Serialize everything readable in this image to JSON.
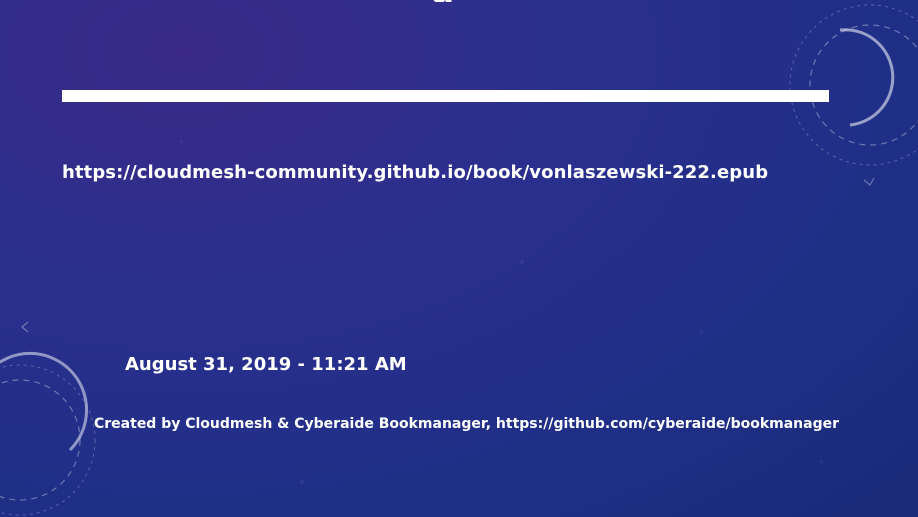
{
  "slide": {
    "title_fragment": "g",
    "url": "https://cloudmesh-community.github.io/book/vonlaszewski-222.epub",
    "date": "August 31, 2019 - 11:21 AM",
    "footer": "Created by Cloudmesh & Cyberaide Bookmanager, https://github.com/cyberaide/bookmanager"
  },
  "colors": {
    "background_top": "#3a2a86",
    "background_bottom": "#1a2a78",
    "text": "#ffffff",
    "divider": "#ffffff"
  },
  "icons": {
    "top_right": "circular-arrows-decoration-icon",
    "bottom_left": "circular-arrows-decoration-icon"
  }
}
